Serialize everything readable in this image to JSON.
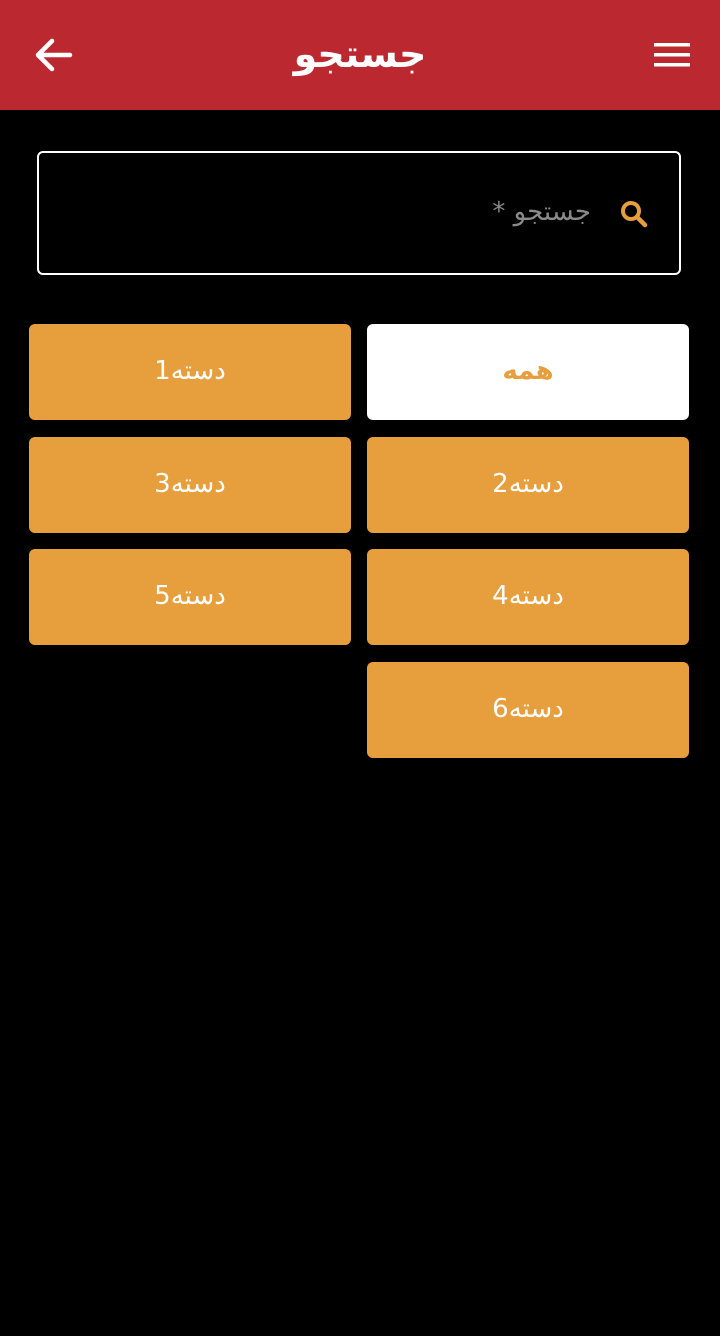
{
  "header": {
    "title": "جستجو",
    "back_icon": "arrow-left-icon",
    "menu_icon": "hamburger-menu-icon",
    "background_color": "#BC2830"
  },
  "search": {
    "placeholder": "جستجو *",
    "value": "",
    "icon": "search-icon",
    "icon_color": "#E79E3C"
  },
  "categories": [
    {
      "label": "همه",
      "selected": true
    },
    {
      "label": "دسته1",
      "selected": false
    },
    {
      "label": "دسته2",
      "selected": false
    },
    {
      "label": "دسته3",
      "selected": false
    },
    {
      "label": "دسته4",
      "selected": false
    },
    {
      "label": "دسته5",
      "selected": false
    },
    {
      "label": "دسته6",
      "selected": false
    }
  ],
  "colors": {
    "accent": "#E79E3C",
    "background": "#000000",
    "selected_bg": "#FFFFFF"
  }
}
